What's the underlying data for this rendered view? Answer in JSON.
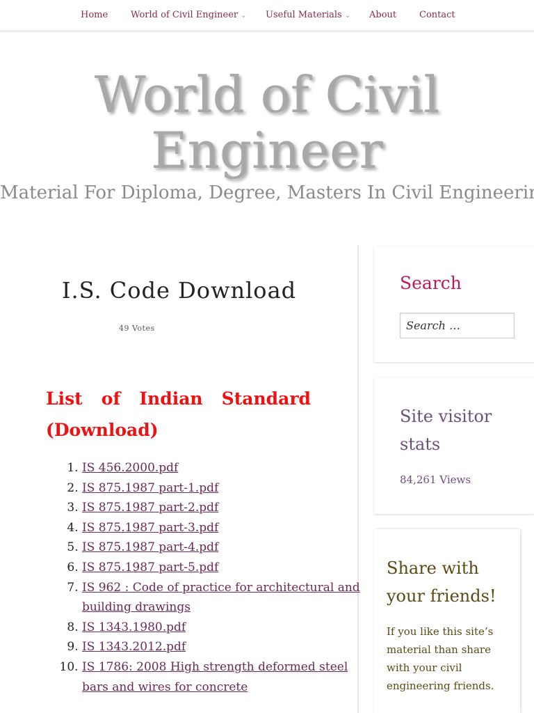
{
  "nav": {
    "items": [
      {
        "label": "Home",
        "has_dropdown": false
      },
      {
        "label": "World of Civil Engineer",
        "has_dropdown": true
      },
      {
        "label": "Useful Materials",
        "has_dropdown": true
      },
      {
        "label": "About",
        "has_dropdown": false
      },
      {
        "label": "Contact",
        "has_dropdown": false
      }
    ],
    "dropdown_icon": "chevron-down-icon",
    "link_color": "#8b2a4a"
  },
  "header": {
    "title": "World of Civil Engineer",
    "tagline": "Material For Diploma, Degree, Masters In Civil Engineering"
  },
  "post": {
    "title": "I.S. Code Download",
    "votes": "49 Votes",
    "list_heading": "List of Indian Standard (Download)",
    "heading_color": "#ee1111",
    "downloads": [
      "IS 456.2000.pdf",
      "IS 875.1987 part-1.pdf",
      "IS 875.1987 part-2.pdf",
      "IS 875.1987 part-3.pdf",
      "IS 875.1987 part-4.pdf",
      "IS 875.1987 part-5.pdf",
      "IS 962 : Code of practice for architectural and building drawings",
      "IS 1343.1980.pdf",
      "IS 1343.2012.pdf",
      "IS 1786: 2008 High strength deformed steel bars and wires for concrete"
    ]
  },
  "sidebar": {
    "search": {
      "title": "Search",
      "placeholder": "Search …"
    },
    "stats": {
      "title": "Site visitor stats",
      "views": "84,261 Views"
    },
    "share": {
      "title": "Share with your friends!",
      "text": "If you like this site’s material than share with your civil engineering friends."
    }
  }
}
